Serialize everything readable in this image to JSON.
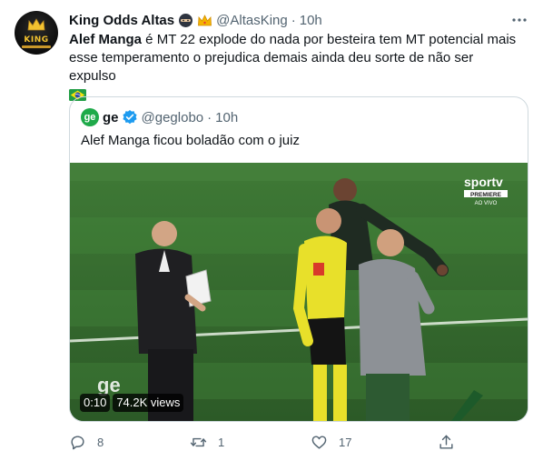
{
  "tweet": {
    "author_name": "King Odds Altas",
    "author_handle": "@AltasKing",
    "separator": "·",
    "time": "10h",
    "avatar_text": "KING",
    "text_bold": "Alef Manga",
    "text_rest": " é MT 22 explode do nada por besteira tem MT potencial mais esse temperamento o prejudica demais ainda deu sorte de não ser expulso"
  },
  "quote": {
    "logo_text": "ge",
    "author_name": "ge",
    "author_handle": "@geglobo",
    "separator": "·",
    "time": "10h",
    "text": "Alef Manga ficou boladão com o juiz",
    "video": {
      "duration": "0:10",
      "views": "74.2K views",
      "channel_logo": "sportv",
      "channel_sub": "PREMIERE",
      "live_label": "AO VIVO",
      "watermark": "ge"
    }
  },
  "actions": {
    "replies": "8",
    "retweets": "1",
    "likes": "17"
  },
  "icons": [
    "more-icon",
    "reply-icon",
    "retweet-icon",
    "like-icon",
    "share-icon",
    "verified-icon",
    "brazil-flag-icon"
  ],
  "colors": {
    "text": "#0f1419",
    "muted": "#536471",
    "border": "#cfd9de",
    "verified": "#1d9bf0",
    "ge_green": "#1faa4a"
  }
}
